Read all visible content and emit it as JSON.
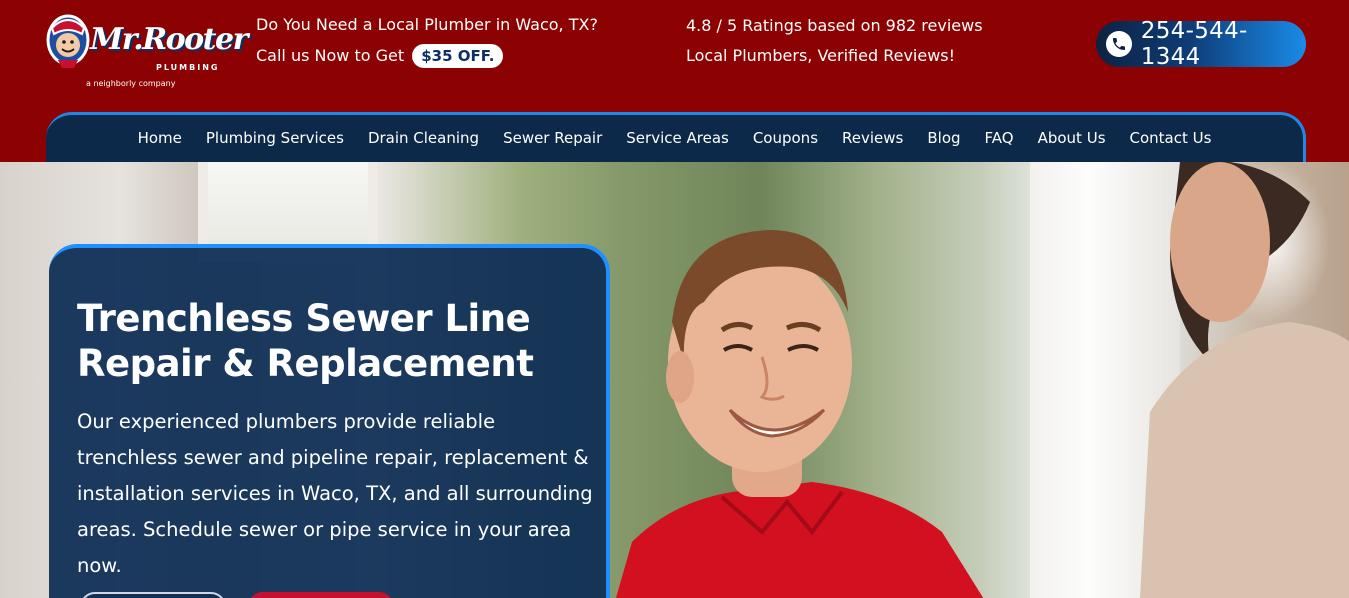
{
  "header": {
    "logo": {
      "brand": "Mr.Rooter",
      "sub": "PLUMBING",
      "tagline": "a neighborly company"
    },
    "promo": {
      "line1": "Do You Need a Local Plumber in Waco, TX?",
      "line2": "Call us Now to Get",
      "badge": "$35 OFF."
    },
    "rating": {
      "line1": "4.8 / 5 Ratings based on 982 reviews",
      "line2": "Local Plumbers, Verified Reviews!"
    },
    "phone": {
      "icon": "phone-icon",
      "number": "254-544-1344"
    }
  },
  "nav": {
    "items": [
      "Home",
      "Plumbing Services",
      "Drain Cleaning",
      "Sewer Repair",
      "Service Areas",
      "Coupons",
      "Reviews",
      "Blog",
      "FAQ",
      "About Us",
      "Contact Us"
    ]
  },
  "hero": {
    "title": "Trenchless Sewer Line Repair & Replacement",
    "description": "Our experienced plumbers provide reliable trenchless sewer and pipeline repair, replacement & installation services in Waco, TX, and all surrounding areas. Schedule sewer or pipe service in your area now."
  },
  "colors": {
    "header_bg": "#8c0202",
    "nav_bg": "#0d2949",
    "accent_blue": "#1e88e5",
    "card_bg": "#0c2c54",
    "cta_red": "#c8102e"
  }
}
